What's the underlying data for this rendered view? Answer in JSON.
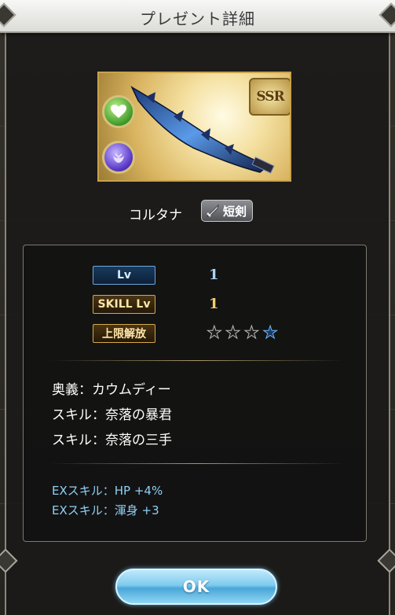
{
  "dialog": {
    "title": "プレゼント詳細"
  },
  "item": {
    "rarity": "SSR",
    "name": "コルタナ",
    "weapon_type": "短剣",
    "element_icon": "heart-icon",
    "skill_icon": "dark-element-icon"
  },
  "stats": {
    "lv_label": "Lv",
    "lv_value": "1",
    "skill_lv_label": "SKILL Lv",
    "skill_lv_value": "1",
    "limit_label": "上限解放",
    "uncap_stars": {
      "filled": 0,
      "total": 4,
      "blue_stars": 1
    }
  },
  "skills": [
    "奥義：カウムディー",
    "スキル：奈落の暴君",
    "スキル：奈落の三手"
  ],
  "ex_skills": [
    "EXスキル：HP +4%",
    "EXスキル：渾身 +3"
  ],
  "ok_label": "OK",
  "colors": {
    "ex_text": "#8ed0f4",
    "ok_button": "#7fcbef",
    "gold_border": "#d6a84c"
  }
}
